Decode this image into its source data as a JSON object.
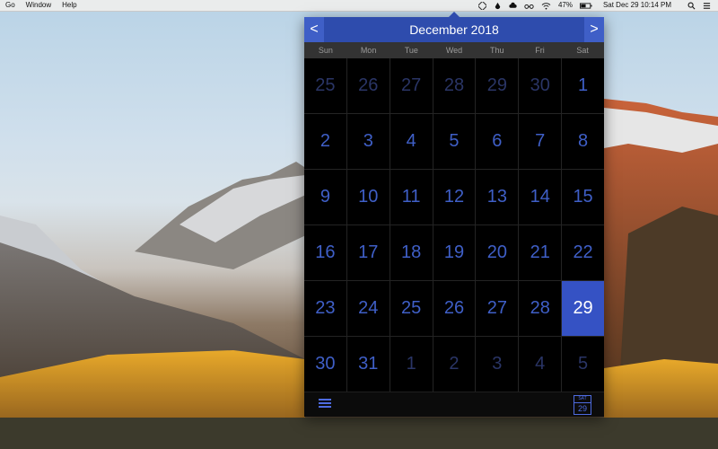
{
  "menubar": {
    "menus": [
      "Go",
      "Window",
      "Help"
    ],
    "status": {
      "battery_text": "47%",
      "clock_text": "Sat Dec 29  10:14 PM"
    },
    "icons": [
      "calendar-app-icon",
      "dropbox-icon",
      "creative-cloud-icon",
      "glasses-icon",
      "wifi-icon",
      "battery-icon",
      "search-icon",
      "list-icon"
    ]
  },
  "calendar": {
    "month_title": "December 2018",
    "prev_label": "<",
    "next_label": ">",
    "weekdays": [
      "Sun",
      "Mon",
      "Tue",
      "Wed",
      "Thu",
      "Fri",
      "Sat"
    ],
    "days": [
      "25",
      "26",
      "27",
      "28",
      "29",
      "30",
      "1",
      "2",
      "3",
      "4",
      "5",
      "6",
      "7",
      "8",
      "9",
      "10",
      "11",
      "12",
      "13",
      "14",
      "15",
      "16",
      "17",
      "18",
      "19",
      "20",
      "21",
      "22",
      "23",
      "24",
      "25",
      "26",
      "27",
      "28",
      "29",
      "30",
      "31",
      "1",
      "2",
      "3",
      "4",
      "5"
    ],
    "today_button": {
      "dow": "SAT",
      "day": "29"
    }
  },
  "colors": {
    "accent": "#2e4cad",
    "day_text": "#3f5fc7",
    "selected_bg": "#3552c4"
  }
}
